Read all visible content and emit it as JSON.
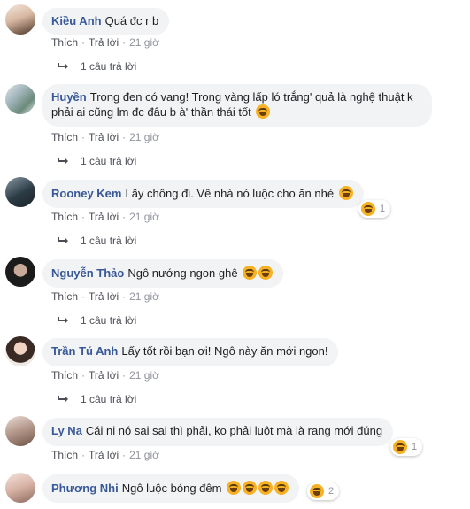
{
  "ui": {
    "like_label": "Thích",
    "reply_label": "Trả lời",
    "separator": "·"
  },
  "colors": {
    "author": "#385898",
    "bubble": "#f2f3f5",
    "meta": "#90949c"
  },
  "comments": [
    {
      "author": "Kiều Anh",
      "text": "Quá đc r b",
      "time": "21 giờ",
      "replies": "1 câu trả lời",
      "emoji_count": 0
    },
    {
      "author": "Huyền",
      "text": "Trong đen có vang! Trong vàng lấp ló trắng' quả là nghệ thuật k phải ai cũng lm đc đâu b à' thần thái tốt",
      "time": "21 giờ",
      "replies": "1 câu trả lời",
      "emoji_count": 1
    },
    {
      "author": "Rooney Kem",
      "text": "Lấy chồng đi. Về nhà nó luộc cho ăn nhé",
      "time": "21 giờ",
      "replies": "1 câu trả lời",
      "emoji_count": 1,
      "reaction": {
        "icon": "haha-icon",
        "count": "1"
      }
    },
    {
      "author": "Nguyễn Thảo",
      "text": "Ngô nướng ngon ghê",
      "time": "21 giờ",
      "replies": "1 câu trả lời",
      "emoji_count": 2
    },
    {
      "author": "Trần Tú Anh",
      "text": "Lấy tốt rồi bạn ơi! Ngô này ăn mới ngon!",
      "time": "21 giờ",
      "replies": "1 câu trả lời",
      "emoji_count": 0
    },
    {
      "author": "Ly Na",
      "text": "Cái ni nó sai sai thì phải, ko phải luột mà là rang mới đúng",
      "time": "21 giờ",
      "emoji_count": 0,
      "reaction": {
        "icon": "haha-icon",
        "count": "1"
      }
    },
    {
      "author": "Phương Nhi",
      "text": "Ngô luộc bóng đêm",
      "emoji_count": 4,
      "reaction": {
        "icon": "haha-icon",
        "count": "2"
      }
    }
  ]
}
